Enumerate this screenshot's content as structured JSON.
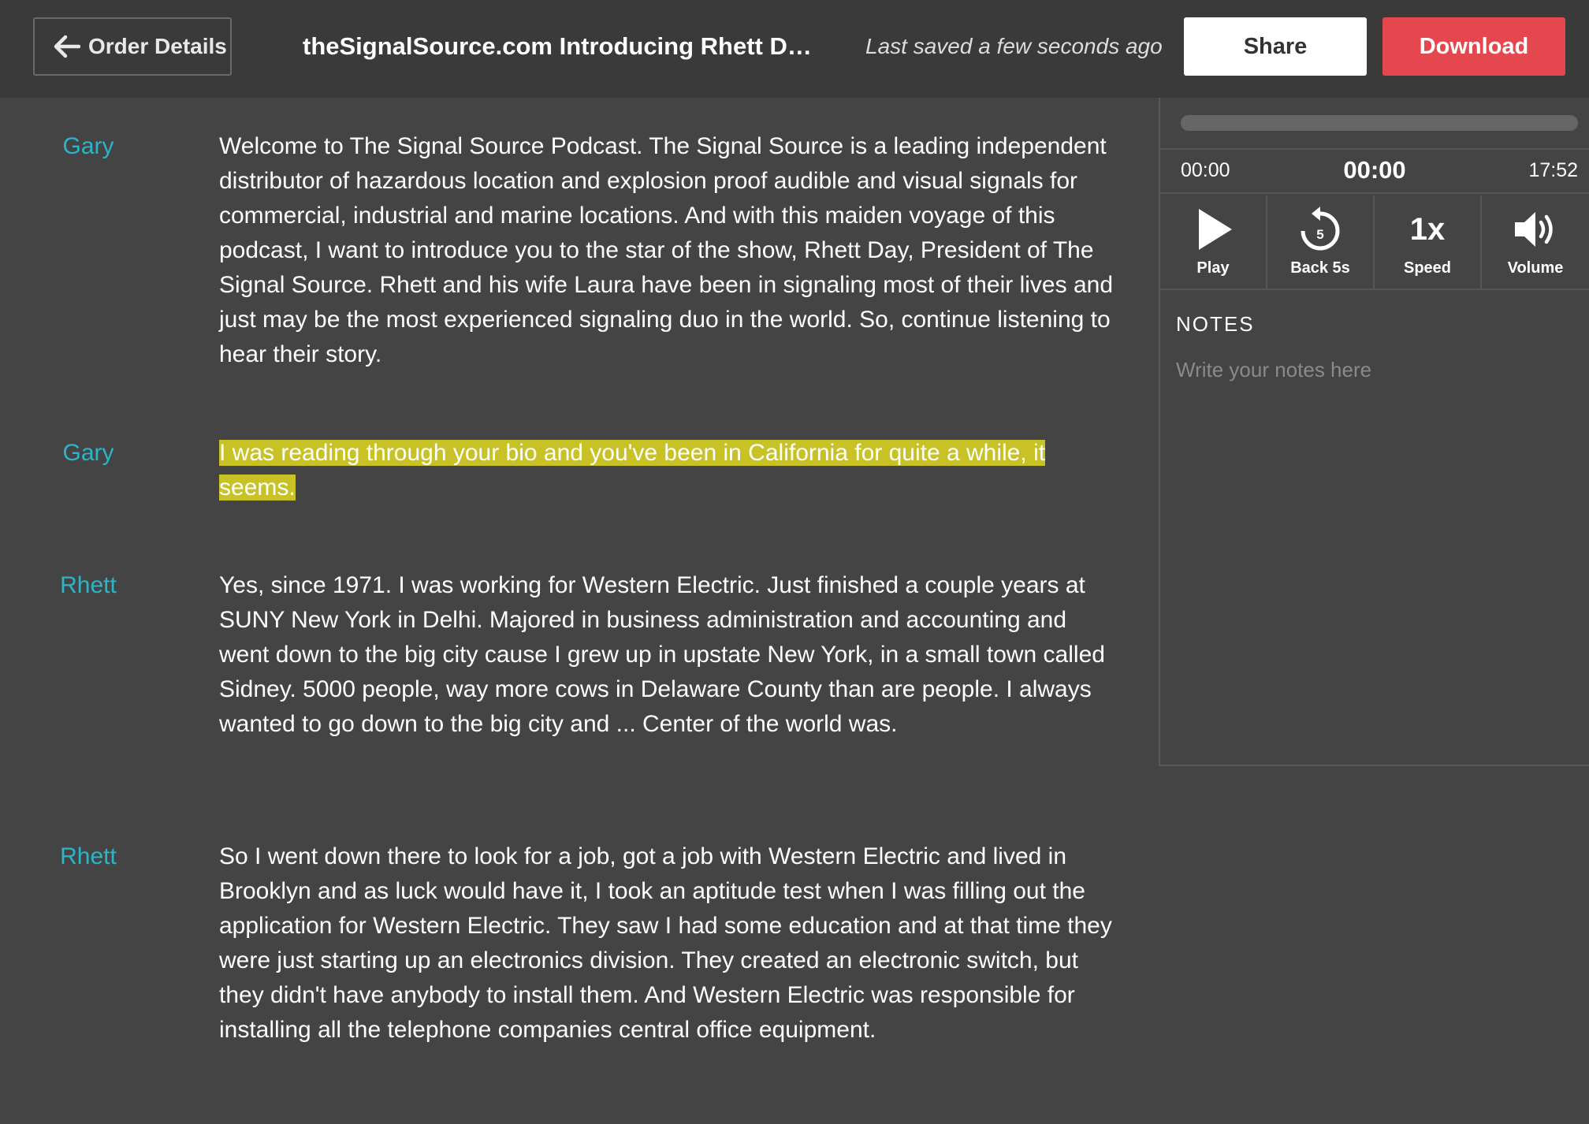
{
  "header": {
    "back_label": "Order Details",
    "title": "theSignalSource.com Introducing Rhett Day_...",
    "saved_status": "Last saved a few seconds ago",
    "share_label": "Share",
    "download_label": "Download"
  },
  "colors": {
    "speaker": "#2bb5c8",
    "highlight": "#c8c227",
    "download": "#e5474f"
  },
  "transcript": [
    {
      "speaker": "Gary",
      "text": "Welcome to The Signal Source Podcast. The Signal Source is a leading independent distributor of hazardous location and explosion proof audible and visual signals for commercial, industrial and marine locations. And with this maiden voyage of this podcast, I want to introduce you to the star of the show, Rhett Day, President of The Signal Source. Rhett and his wife Laura have been in signaling most of their lives and just may be the most experienced signaling duo in the world. So, continue listening to hear their story."
    },
    {
      "speaker": "Gary",
      "text": "I was reading through your bio and you've been in California for quite a while, it seems.",
      "highlighted": true
    },
    {
      "speaker": "Rhett",
      "text": "Yes, since 1971. I was working for Western Electric. Just finished a couple years at SUNY New York in Delhi. Majored in business administration and accounting and went down to the big city cause I grew up in upstate New York, in a small town called Sidney. 5000 people, way more cows in Delaware County than are people. I always wanted to go down to the big city and ... Center of the world was."
    },
    {
      "speaker": "Rhett",
      "text": "So I went down there to look for a job, got a job with Western Electric and lived in Brooklyn and as luck would have it, I took an aptitude test when I was filling out the application for Western Electric. They saw I had some education and at that time they were just starting up an electronics division. They created an electronic switch, but they didn't have anybody to install them. And Western Electric was responsible for installing all the telephone companies central office equipment."
    }
  ],
  "player": {
    "progress": 0,
    "time_start": "00:00",
    "time_current": "00:00",
    "time_end": "17:52",
    "controls": {
      "play_label": "Play",
      "back_label": "Back 5s",
      "back_seconds": "5",
      "speed_value": "1x",
      "speed_label": "Speed",
      "volume_label": "Volume"
    },
    "icons": [
      "play-icon",
      "rewind-5-icon",
      "volume-icon"
    ]
  },
  "notes": {
    "title": "NOTES",
    "placeholder": "Write your notes here"
  }
}
